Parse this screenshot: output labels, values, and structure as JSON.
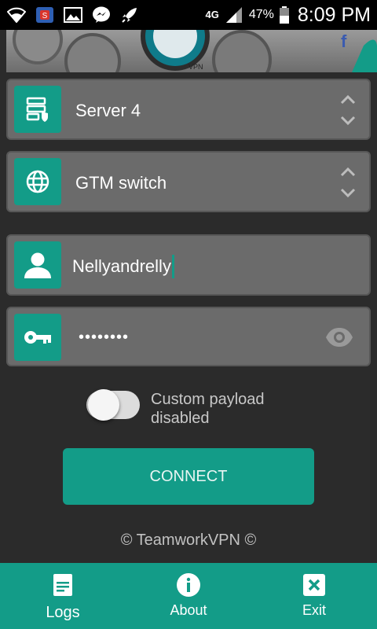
{
  "status_bar": {
    "network": "4G",
    "battery": "47%",
    "time": "8:09 PM",
    "icons": [
      "wifi-icon",
      "app-notification-icon",
      "image-icon",
      "messenger-icon",
      "rocket-icon"
    ]
  },
  "server_select": {
    "value": "Server 4",
    "icon": "server-shield-icon"
  },
  "network_select": {
    "value": "GTM switch",
    "icon": "globe-icon"
  },
  "username": {
    "value": "Nellyandrelly",
    "icon": "user-icon"
  },
  "password": {
    "value": "••••••••",
    "icon": "key-icon"
  },
  "payload": {
    "label": "Custom payload disabled",
    "enabled": false
  },
  "connect_button": {
    "label": "CONNECT"
  },
  "footer": {
    "copyright": "© TeamworkVPN ©"
  },
  "bottom_nav": {
    "items": [
      {
        "label": "Logs",
        "icon": "logs-icon"
      },
      {
        "label": "About",
        "icon": "info-icon"
      },
      {
        "label": "Exit",
        "icon": "close-icon"
      }
    ]
  },
  "colors": {
    "accent": "#139c88",
    "card": "#6b6b6b",
    "background": "#2b2b2b"
  }
}
